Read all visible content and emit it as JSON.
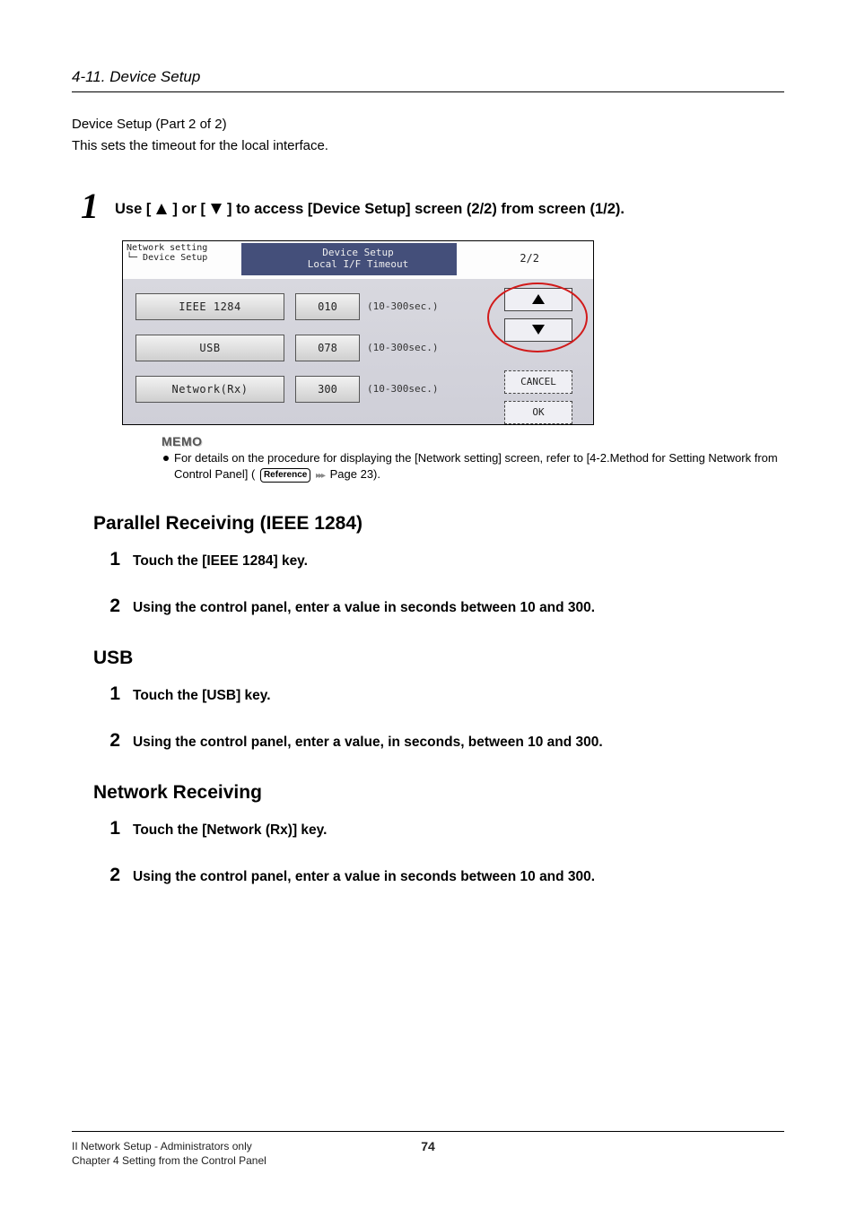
{
  "running_head": "4-11. Device Setup",
  "intro_line1": "Device Setup (Part 2 of 2)",
  "intro_line2": "This sets the timeout for the local interface.",
  "step1_prefix": "Use [",
  "step1_mid": "] or [",
  "step1_suffix": "] to access [Device Setup] screen (2/2) from screen (1/2).",
  "screenshot": {
    "breadcrumb_line1": "Network setting",
    "breadcrumb_line2": "└─ Device Setup",
    "title_line1": "Device Setup",
    "title_line2": "Local I/F Timeout",
    "page_indicator": "2/2",
    "rows": [
      {
        "key": "IEEE 1284",
        "value": "010",
        "range": "(10-300sec.)"
      },
      {
        "key": "USB",
        "value": "078",
        "range": "(10-300sec.)"
      },
      {
        "key": "Network(Rx)",
        "value": "300",
        "range": "(10-300sec.)"
      }
    ],
    "cancel": "CANCEL",
    "ok": "OK"
  },
  "memo_label": "MEMO",
  "memo_text_before_ref": "For details on the procedure for displaying the [Network setting] screen, refer to [4-2.Method for Setting Network from Control Panel] (",
  "memo_ref_label": "Reference",
  "memo_text_after_ref": " Page 23).",
  "sections": [
    {
      "heading": "Parallel Receiving (IEEE 1284)",
      "steps": [
        "Touch the [IEEE 1284] key.",
        "Using the control panel, enter a value in seconds between 10 and 300."
      ]
    },
    {
      "heading": "USB",
      "steps": [
        "Touch the [USB] key.",
        "Using the control panel, enter a value, in seconds, between 10 and 300."
      ]
    },
    {
      "heading": "Network Receiving",
      "steps": [
        "Touch the [Network (Rx)] key.",
        "Using the control panel, enter a value in seconds between 10 and 300."
      ]
    }
  ],
  "footer_line1": "II Network Setup - Administrators only",
  "footer_line2": "Chapter 4 Setting from the Control Panel",
  "page_number": "74"
}
